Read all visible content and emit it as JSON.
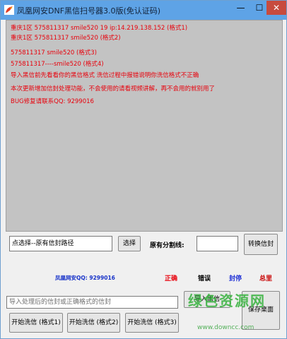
{
  "window": {
    "title": "凤凰网安DNF黑信扫号器3.0版(免认证码)",
    "minimize_glyph": "—",
    "maximize_glyph": "☐",
    "close_glyph": "✕",
    "icon": "phoenix-app-icon"
  },
  "log": {
    "lines": [
      "重庆1区 575811317 smile520 19 ip:14.219.138.152   (格式1)",
      "重庆1区 575811317 smile520 (格式2)",
      "575811317 smile520 (格式3)",
      "575811317----smile520 (格式4)",
      "导入黑信前先看看你的黑信格式  洗信过程中报错说明你洗信格式不正确",
      "本次更新增加信封处理功能，不会使用的请看视频讲解，再不会用的就别用了",
      "BUG修复请联系QQ: 9299016"
    ],
    "text_color": "#e8000b",
    "background": "#c3c3c3"
  },
  "controls": {
    "path_input_value": "点选择--原有信封路径",
    "select_button": "选择",
    "separator_label": "原有分割线:",
    "separator_input_value": "",
    "convert_button": "转换信封",
    "qq_label": "凤凰网安QQ: 9299016",
    "stat_correct": "正确",
    "stat_error": "错误",
    "stat_banned": "封停",
    "stat_total": "总里",
    "import_input_placeholder": "导入处理后的信封或正确格式的信封",
    "import_button": "导入黑信",
    "save_button": "保存桌面",
    "wash1_button": "开始洗信 (格式1)",
    "wash2_button": "开始洗信 (格式2)",
    "wash3_button": "开始洗信 (格式3)"
  },
  "watermark": {
    "text": "绿色资源网",
    "url": "www.downcc.com"
  },
  "colors": {
    "titlebar": "#5ea3e6",
    "close_button": "#c74b3e",
    "qq_label": "#1833c9",
    "correct": "#e8000b",
    "error": "#000000",
    "banned": "#2233d6",
    "total": "#c80000",
    "watermark": "#35b23c"
  }
}
